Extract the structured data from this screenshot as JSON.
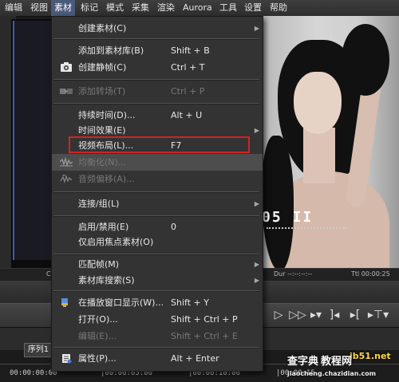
{
  "menubar": {
    "items": [
      {
        "label": "编辑"
      },
      {
        "label": "视图"
      },
      {
        "label": "素材"
      },
      {
        "label": "标记"
      },
      {
        "label": "模式"
      },
      {
        "label": "采集"
      },
      {
        "label": "渲染"
      },
      {
        "label": "Aurora"
      },
      {
        "label": "工具"
      },
      {
        "label": "设置"
      },
      {
        "label": "帮助"
      }
    ]
  },
  "preview": {
    "timecode": "05 II",
    "status_left": "C",
    "status_dur": "Dur --:--:--:--",
    "status_ttl": "Ttl 00:00:25"
  },
  "timeline": {
    "tab_label": "序列1",
    "ruler": [
      "00:00:00:00",
      "|00:00:05:00",
      "|00:00:10:00",
      "|00:00:15"
    ]
  },
  "menu": {
    "items": [
      {
        "label": "创建素材(C)",
        "shortcut": "",
        "submenu": true,
        "disabled": false
      },
      {
        "label": "添加到素材库(B)",
        "shortcut": "Shift + B",
        "submenu": false,
        "disabled": false
      },
      {
        "label": "创建静帧(C)",
        "shortcut": "Ctrl + T",
        "submenu": false,
        "disabled": false,
        "icon": "camera-icon"
      },
      {
        "label": "添加转场(T)",
        "shortcut": "Ctrl + P",
        "submenu": false,
        "disabled": true,
        "icon": "transition-icon"
      },
      {
        "label": "持续时间(D)...",
        "shortcut": "Alt + U",
        "submenu": false,
        "disabled": false
      },
      {
        "label": "时间效果(E)",
        "shortcut": "",
        "submenu": true,
        "disabled": false
      },
      {
        "label": "视频布局(L)...",
        "shortcut": "F7",
        "submenu": false,
        "disabled": false
      },
      {
        "label": "均衡化(N)...",
        "shortcut": "",
        "submenu": false,
        "disabled": true,
        "icon": "waveform-icon"
      },
      {
        "label": "音频偏移(A)...",
        "shortcut": "",
        "submenu": false,
        "disabled": true,
        "icon": "audio-offset-icon"
      },
      {
        "label": "连接/组(L)",
        "shortcut": "",
        "submenu": true,
        "disabled": false
      },
      {
        "label": "启用/禁用(E)",
        "shortcut": "0",
        "submenu": false,
        "disabled": false
      },
      {
        "label": "仅启用焦点素材(O)",
        "shortcut": "",
        "submenu": false,
        "disabled": false
      },
      {
        "label": "匹配帧(M)",
        "shortcut": "",
        "submenu": true,
        "disabled": false
      },
      {
        "label": "素材库搜索(S)",
        "shortcut": "",
        "submenu": true,
        "disabled": false
      },
      {
        "label": "在播放窗口显示(W)...",
        "shortcut": "Shift + Y",
        "submenu": false,
        "disabled": false,
        "icon": "player-window-icon"
      },
      {
        "label": "打开(O)...",
        "shortcut": "Shift + Ctrl + P",
        "submenu": false,
        "disabled": false
      },
      {
        "label": "编辑(E)...",
        "shortcut": "Shift + Ctrl + E",
        "submenu": false,
        "disabled": true
      },
      {
        "label": "属性(P)...",
        "shortcut": "Alt + Enter",
        "submenu": false,
        "disabled": false,
        "icon": "properties-icon"
      }
    ]
  },
  "watermark": {
    "line1": "查字典",
    "line2": "教程网",
    "site": "jb51.net",
    "url": "jiaocheng.chazidian.com"
  },
  "colors": {
    "highlight_box": "#d32323",
    "menu_bg": "#333333",
    "active_menu": "#4a5a7a"
  }
}
